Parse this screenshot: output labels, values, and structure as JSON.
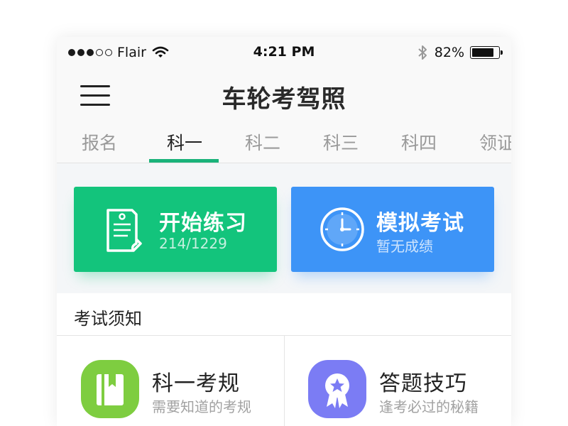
{
  "status_bar": {
    "signal_full": 3,
    "signal_empty": 2,
    "carrier": "Flair",
    "time": "4:21 PM",
    "battery_percent": "82%",
    "battery_level": 0.82
  },
  "header": {
    "menu_icon": "hamburger-icon",
    "title": "车轮考驾照"
  },
  "tabs": [
    {
      "label": "报名",
      "active": false
    },
    {
      "label": "科一",
      "active": true
    },
    {
      "label": "科二",
      "active": false
    },
    {
      "label": "科三",
      "active": false
    },
    {
      "label": "科四",
      "active": false
    },
    {
      "label": "领证",
      "active": false
    }
  ],
  "cards": {
    "practice": {
      "title": "开始练习",
      "subtitle": "214/1229",
      "icon": "document-icon",
      "color": "#13c47c"
    },
    "exam": {
      "title": "模拟考试",
      "subtitle": "暂无成绩",
      "icon": "clock-icon",
      "color": "#3d94f7"
    }
  },
  "notice": {
    "title": "考试须知"
  },
  "grid": {
    "rules": {
      "title": "科一考规",
      "subtitle": "需要知道的考规",
      "icon": "book-icon",
      "color": "#7ecd40"
    },
    "tips": {
      "title": "答题技巧",
      "subtitle": "逢考必过的秘籍",
      "icon": "medal-icon",
      "color": "#7b7cf4"
    }
  },
  "colors": {
    "accent_green": "#1ab27a"
  }
}
